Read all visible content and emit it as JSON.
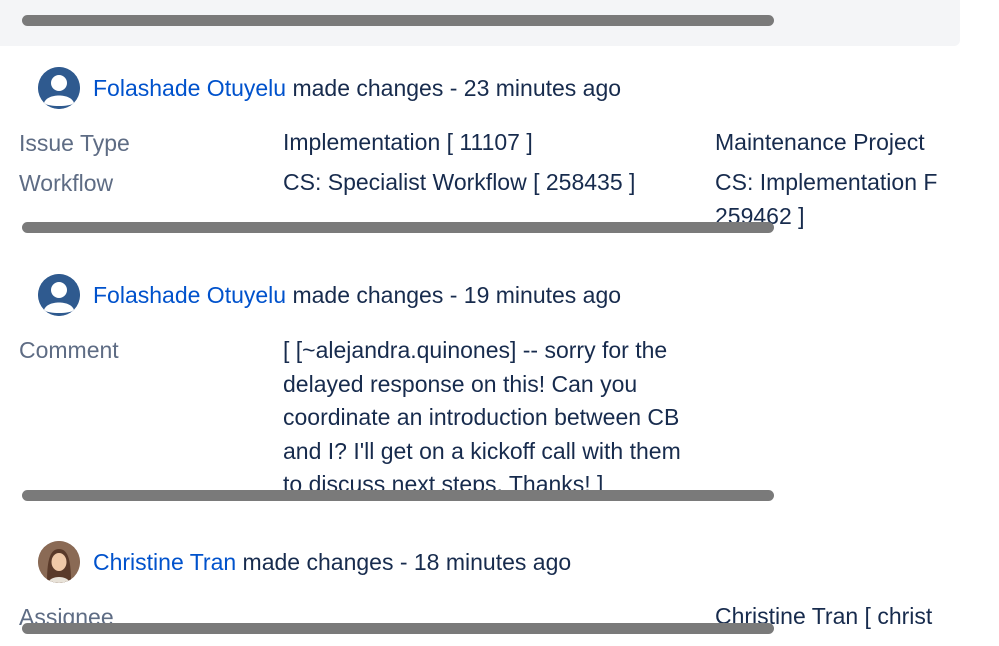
{
  "history": [
    {
      "author": "Folashade Otuyelu",
      "action": " made changes - 23 minutes ago",
      "rows": [
        {
          "field": "Issue Type",
          "old_value": "Implementation [ 11107 ]",
          "new_value": "Maintenance Project"
        },
        {
          "field": "Workflow",
          "old_value": "CS: Specialist Workflow [ 258435 ]",
          "new_value": "CS: Implementation F 259462 ]"
        }
      ]
    },
    {
      "author": "Folashade Otuyelu",
      "action": " made changes - 19 minutes ago",
      "rows": [
        {
          "field": "Comment",
          "old_value": "[ [~alejandra.quinones] -- sorry for the delayed response on this! Can you coordinate an introduction between CB and I? I'll get on a kickoff call with them to discuss next steps. Thanks! ]"
        }
      ]
    },
    {
      "author": "Christine Tran",
      "action": " made changes - 18 minutes ago",
      "rows": [
        {
          "field": "Assignee",
          "new_value": "Christine Tran [ christ"
        }
      ]
    }
  ],
  "icons": {
    "generic_avatar": "default-user-avatar-icon",
    "photo_avatar": "user-photo-avatar"
  },
  "colors": {
    "link": "#0052cc",
    "label": "#5e6c84",
    "text": "#172b4d",
    "avatar_blue": "#2f5a8f"
  }
}
